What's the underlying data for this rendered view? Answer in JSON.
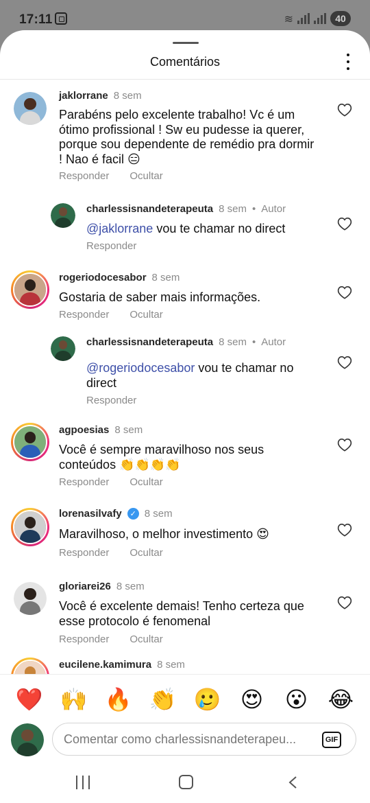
{
  "status_bar": {
    "time": "17:11",
    "battery": "40"
  },
  "sheet": {
    "title": "Comentários"
  },
  "comments": [
    {
      "user": "jaklorrane",
      "time": "8 sem",
      "text": "Parabéns pelo excelente trabalho! Vc é um ótimo profissional ! Sw eu pudesse ia querer, porque sou dependente de remédio pra dormir ! Nao é facil 😑",
      "reply_label": "Responder",
      "hide_label": "Ocultar"
    },
    {
      "user": "charlessisnandeterapeuta",
      "time": "8 sem",
      "author_tag": "Autor",
      "mention": "@jaklorrane",
      "text": " vou te chamar no direct",
      "reply_label": "Responder"
    },
    {
      "user": "rogeriodocesabor",
      "time": "8 sem",
      "text": "Gostaria de saber mais informações.",
      "reply_label": "Responder",
      "hide_label": "Ocultar"
    },
    {
      "user": "charlessisnandeterapeuta",
      "time": "8 sem",
      "author_tag": "Autor",
      "mention": "@rogeriodocesabor",
      "text": " vou te chamar no direct",
      "reply_label": "Responder"
    },
    {
      "user": "agpoesias",
      "time": "8 sem",
      "text": "Você é sempre maravilhoso nos seus conteúdos 👏👏👏👏",
      "reply_label": "Responder",
      "hide_label": "Ocultar"
    },
    {
      "user": "lorenasilvafy",
      "time": "8 sem",
      "text": "Maravilhoso, o melhor investimento 😍",
      "reply_label": "Responder",
      "hide_label": "Ocultar"
    },
    {
      "user": "gloriarei26",
      "time": "8 sem",
      "text": "Você é excelente demais! Tenho certeza que esse protocolo é fenomenal",
      "reply_label": "Responder",
      "hide_label": "Ocultar"
    },
    {
      "user": "eucilene.kamimura",
      "time": "8 sem"
    }
  ],
  "reactions": [
    "❤️",
    "🙌",
    "🔥",
    "👏",
    "🥲",
    "😍",
    "😮",
    "😂"
  ],
  "composer": {
    "placeholder": "Comentar como charlessisnandeterapeu...",
    "gif_label": "GIF"
  },
  "icons": {
    "like": "heart-outline-icon",
    "menu": "more-vertical-icon",
    "verified": "verified-badge-icon"
  },
  "colors": {
    "mention": "#3d4fa8",
    "verified": "#3897f0",
    "muted": "#8a8a8a"
  }
}
